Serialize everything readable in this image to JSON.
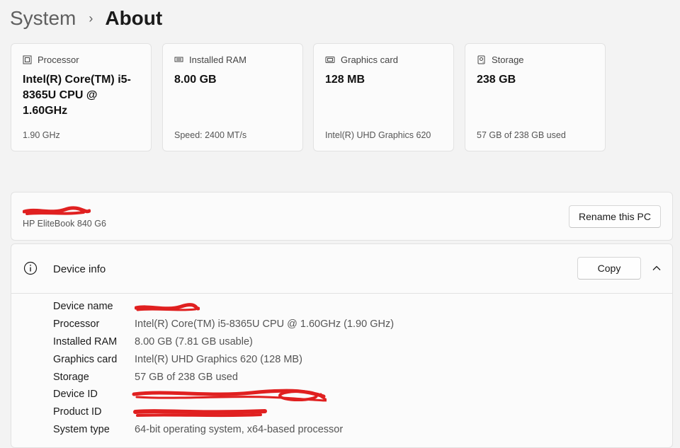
{
  "breadcrumb": {
    "parent": "System",
    "separator": "›",
    "current": "About"
  },
  "cards": [
    {
      "icon": "processor-icon",
      "label": "Processor",
      "value": "Intel(R) Core(TM) i5-8365U CPU @ 1.60GHz",
      "sub": "1.90 GHz"
    },
    {
      "icon": "ram-icon",
      "label": "Installed RAM",
      "value": "8.00 GB",
      "sub": "Speed: 2400 MT/s"
    },
    {
      "icon": "graphics-card-icon",
      "label": "Graphics card",
      "value": "128 MB",
      "sub": "Intel(R) UHD Graphics 620"
    },
    {
      "icon": "storage-icon",
      "label": "Storage",
      "value": "238 GB",
      "sub": "57 GB of 238 GB used"
    }
  ],
  "pc": {
    "name": "",
    "model": "HP EliteBook 840 G6",
    "rename_label": "Rename this PC"
  },
  "device_info": {
    "title": "Device info",
    "copy_label": "Copy",
    "rows": [
      {
        "key": "Device name",
        "value": ""
      },
      {
        "key": "Processor",
        "value": "Intel(R) Core(TM) i5-8365U CPU @ 1.60GHz (1.90 GHz)"
      },
      {
        "key": "Installed RAM",
        "value": "8.00 GB (7.81 GB usable)"
      },
      {
        "key": "Graphics card",
        "value": "Intel(R) UHD Graphics 620 (128 MB)"
      },
      {
        "key": "Storage",
        "value": "57 GB of 238 GB used"
      },
      {
        "key": "Device ID",
        "value": ""
      },
      {
        "key": "Product ID",
        "value": ""
      },
      {
        "key": "System type",
        "value": "64-bit operating system, x64-based processor"
      }
    ]
  },
  "colors": {
    "redaction": "#e02020",
    "background": "#f3f3f3",
    "card": "#fbfbfb"
  }
}
